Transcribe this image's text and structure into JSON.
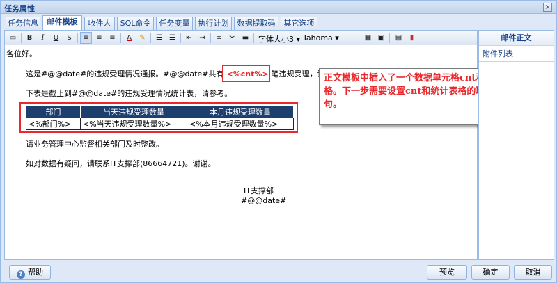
{
  "window": {
    "title": "任务属性",
    "close_glyph": "×"
  },
  "tabs": [
    {
      "label": "任务信息",
      "active": false
    },
    {
      "label": "邮件模板",
      "active": true
    },
    {
      "label": "收件人",
      "active": false
    },
    {
      "label": "SQL命令",
      "active": false
    },
    {
      "label": "任务变量",
      "active": false
    },
    {
      "label": "执行计划",
      "active": false
    },
    {
      "label": "数据提取码",
      "active": false
    },
    {
      "label": "其它选项",
      "active": false
    }
  ],
  "toolbar": {
    "font_size_label": "字体大小3",
    "font_name": "Tahoma",
    "icons": [
      "source-icon",
      "bold-icon",
      "italic-icon",
      "underline-icon",
      "strikethrough-icon",
      "align-left-icon",
      "align-center-icon",
      "align-right-icon",
      "font-color-icon",
      "highlight-icon",
      "bullet-list-icon",
      "number-list-icon",
      "outdent-icon",
      "indent-icon",
      "link-icon",
      "unlink-icon",
      "hr-icon",
      "table-icon",
      "image-icon",
      "data-cell-icon",
      "chart-icon"
    ]
  },
  "editor": {
    "greeting": "各位好。",
    "para1_before": "这是#@@date#的违规受理情况通报。#@@date#共有",
    "cnt_placeholder": "<%cnt%>",
    "para1_after": "笔违规受理，详细情况请见附件。",
    "para2": "下表是截止到#@@date#的违规受理情况统计表，请参考。",
    "table": {
      "headers": [
        "部门",
        "当天违规受理数量",
        "本月违规受理数量"
      ],
      "row": [
        "<%部门%>",
        "<%当天违规受理数量%>",
        "<%本月违规受理数量%>"
      ]
    },
    "para3": "请业务管理中心监督相关部门及时整改。",
    "para4": "如对数据有疑问，请联系IT支撑部(86664721)。谢谢。",
    "sign_dept": "IT支撑部",
    "sign_date": "#@@date#"
  },
  "callout": {
    "text": "正文模板中插入了一个数据单元格cnt和一个统计表格。下一步需要设置cnt和统计表格的取数SQL语句。"
  },
  "sidepanel": {
    "items": [
      {
        "label": "邮件正文",
        "active": true
      },
      {
        "label": "附件列表",
        "active": false
      }
    ]
  },
  "footer": {
    "help": "帮助",
    "preview": "预览",
    "ok": "确定",
    "cancel": "取消"
  },
  "colors": {
    "accent_red": "#e8282c",
    "table_header": "#1d3f6e",
    "frame_blue": "#99bbe8"
  }
}
